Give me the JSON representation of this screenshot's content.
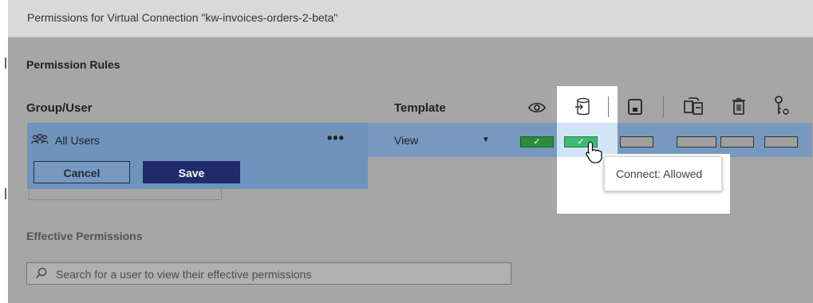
{
  "dialog": {
    "title": "Permissions for Virtual Connection \"kw-invoices-orders-2-beta\""
  },
  "permission_rules": {
    "heading": "Permission Rules",
    "columns": {
      "group_user": "Group/User",
      "template": "Template"
    },
    "capability_icons": [
      "view-icon",
      "connect-icon",
      "save-icon",
      "change-owner-icon",
      "delete-icon",
      "set-permissions-icon"
    ],
    "row": {
      "icon": "users-group-icon",
      "label": "All Users",
      "more": "•••",
      "template_value": "View",
      "capabilities": [
        {
          "name": "view",
          "state": "allowed",
          "check": "✓"
        },
        {
          "name": "connect",
          "state": "allowed",
          "check": "✓"
        },
        {
          "name": "save",
          "state": "unspecified"
        },
        {
          "name": "change-owner",
          "state": "unspecified"
        },
        {
          "name": "delete",
          "state": "unspecified"
        },
        {
          "name": "set-permissions",
          "state": "unspecified"
        }
      ]
    },
    "buttons": {
      "cancel": "Cancel",
      "save": "Save"
    },
    "tooltip": "Connect: Allowed"
  },
  "effective_permissions": {
    "heading": "Effective Permissions",
    "search_placeholder": "Search for a user to view their effective permissions"
  },
  "colors": {
    "allowed": "#2e8b3e",
    "row_highlight": "#7799bf",
    "save_button": "#1f2b6b"
  }
}
